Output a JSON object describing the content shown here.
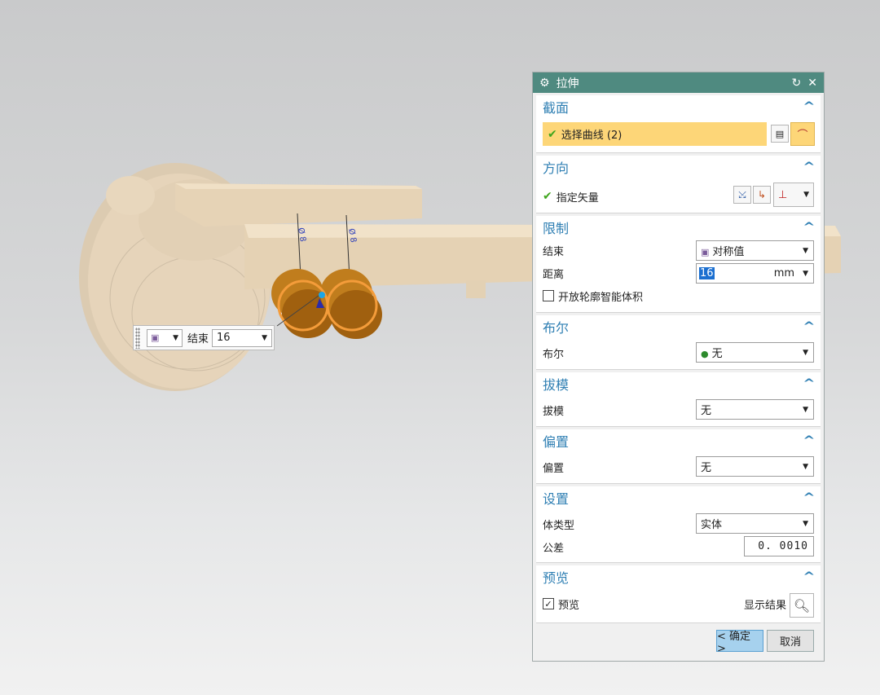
{
  "canvas": {
    "dims": [
      "Ø 8",
      "Ø 8"
    ],
    "mini_toolbar": {
      "end_label": "结束",
      "end_value": "16"
    }
  },
  "dialog": {
    "title": "拉伸",
    "sections": {
      "section": {
        "title": "截面",
        "select_curve": "选择曲线 (2)"
      },
      "direction": {
        "title": "方向",
        "vector": "指定矢量"
      },
      "limits": {
        "title": "限制",
        "end_label": "结束",
        "end_value": "对称值",
        "distance_label": "距离",
        "distance_value": "16",
        "distance_unit": "mm",
        "open_profile": "开放轮廓智能体积"
      },
      "boolean": {
        "title": "布尔",
        "label": "布尔",
        "value": "无"
      },
      "draft": {
        "title": "拔模",
        "label": "拔模",
        "value": "无"
      },
      "offset": {
        "title": "偏置",
        "label": "偏置",
        "value": "无"
      },
      "settings": {
        "title": "设置",
        "body_type_label": "体类型",
        "body_type_value": "实体",
        "tolerance_label": "公差",
        "tolerance_value": "0. 0010"
      },
      "preview": {
        "title": "预览",
        "preview_label": "预览",
        "show_result": "显示结果"
      }
    },
    "buttons": {
      "ok": "< 确定 >",
      "cancel": "取消"
    }
  },
  "colors": {
    "title_bar": "#4f8a80",
    "section_title": "#2f7fb3",
    "highlight": "#fdd678",
    "ok_button": "#a6d1ee",
    "part_body": "#e8d6bc",
    "cylinder": "#b86f12",
    "outline_orange": "#f39a3a"
  }
}
